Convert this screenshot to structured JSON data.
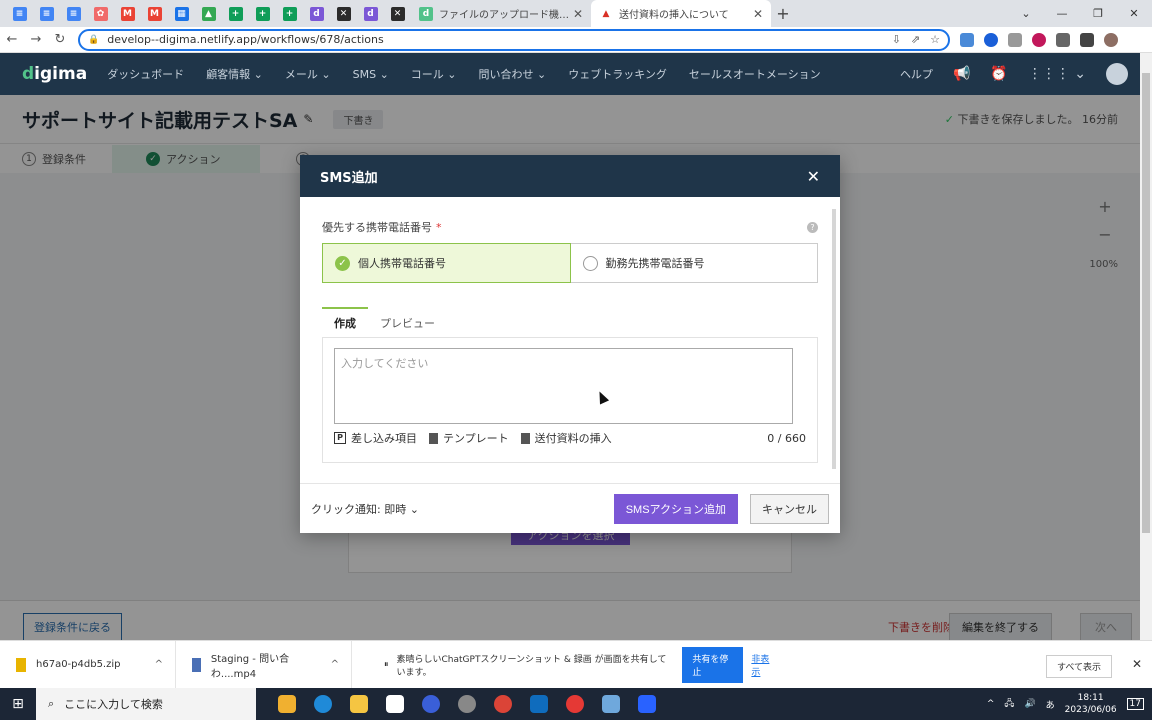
{
  "browser": {
    "pinned_tabs": [
      {
        "icon": "docs-icon",
        "color": "#4285f4",
        "glyph": "≡"
      },
      {
        "icon": "docs-icon",
        "color": "#4285f4",
        "glyph": "≡"
      },
      {
        "icon": "docs-icon",
        "color": "#4285f4",
        "glyph": "≡"
      },
      {
        "icon": "asana-icon",
        "color": "#f06a6a",
        "glyph": "✿"
      },
      {
        "icon": "gmail-icon",
        "color": "#ea4335",
        "glyph": "M"
      },
      {
        "icon": "gmail-icon",
        "color": "#ea4335",
        "glyph": "M"
      },
      {
        "icon": "calendar-icon",
        "color": "#1a73e8",
        "glyph": "▦"
      },
      {
        "icon": "drive-icon",
        "color": "#34a853",
        "glyph": "▲"
      },
      {
        "icon": "sheets-icon",
        "color": "#0f9d58",
        "glyph": "+"
      },
      {
        "icon": "sheets-icon",
        "color": "#0f9d58",
        "glyph": "+"
      },
      {
        "icon": "sheets-icon",
        "color": "#0f9d58",
        "glyph": "+"
      },
      {
        "icon": "digima-icon",
        "color": "#7b57d6",
        "glyph": "d"
      },
      {
        "icon": "app-icon",
        "color": "#2b2b2b",
        "glyph": "✕"
      },
      {
        "icon": "digima-icon",
        "color": "#7b57d6",
        "glyph": "d"
      },
      {
        "icon": "app-icon",
        "color": "#2b2b2b",
        "glyph": "✕"
      }
    ],
    "tabs": [
      {
        "title": "ファイルのアップロード機能について - ",
        "favicon_color": "#52c28a",
        "glyph": "d"
      },
      {
        "title": "送付資料の挿入について",
        "favicon_color": "#d93025",
        "glyph": "▲"
      }
    ],
    "new_tab": "+",
    "window_controls": [
      "⌄",
      "—",
      "❐",
      "✕"
    ],
    "url": "develop--digima.netlify.app/workflows/678/actions"
  },
  "appnav": {
    "logo_prefix": "d",
    "logo_rest": "igima",
    "items": [
      "ダッシュボード",
      "顧客情報 ⌄",
      "メール ⌄",
      "SMS ⌄",
      "コール ⌄",
      "問い合わせ ⌄",
      "ウェブトラッキング",
      "セールスオートメーション"
    ],
    "help": "ヘルプ"
  },
  "page": {
    "title": "サポートサイト記載用テストSA",
    "status": "下書き",
    "saved_check": "✓ ",
    "saved_text": "下書きを保存しました。",
    "saved_time": "16分前",
    "steps": [
      {
        "num": "1",
        "label": "登録条件"
      },
      {
        "num": "✓",
        "label": "アクション"
      },
      {
        "num": "3",
        "label": ""
      }
    ],
    "zoom_plus": "+",
    "zoom_minus": "−",
    "zoom_level": "100%",
    "back_button": "登録条件に戻る",
    "delete_draft": "下書きを削除",
    "finish_edit": "編集を終了する",
    "next": "次へ",
    "behind_button": "アクションを選択"
  },
  "modal": {
    "title": "SMS追加",
    "close": "✕",
    "field_label": "優先する携帯電話番号",
    "required_mark": "*",
    "help": "?",
    "options": [
      "個人携帯電話番号",
      "勤務先携帯電話番号"
    ],
    "selected_option_index": 0,
    "tabs": [
      "作成",
      "プレビュー"
    ],
    "active_tab": "作成",
    "textarea_placeholder": "入力してください",
    "tools": [
      "差し込み項目",
      "テンプレート",
      "送付資料の挿入"
    ],
    "char_count": "0 / 660",
    "click_notice": "クリック通知: 即時 ⌄",
    "primary_button": "SMSアクション追加",
    "cancel_button": "キャンセル"
  },
  "downloads": {
    "items": [
      {
        "name": "h67a0-p4db5.zip"
      },
      {
        "name": "Staging - 問い合わ....mp4"
      }
    ],
    "share_text": "素晴らしいChatGPTスクリーンショット & 録画 が画面を共有しています。",
    "stop_share": "共有を停止",
    "hide": "非表示",
    "show_all": "すべて表示"
  },
  "taskbar": {
    "search_placeholder": "ここに入力して検索",
    "time": "18:11",
    "date": "2023/06/06",
    "ime": "あ",
    "notifications": "17"
  },
  "colors": {
    "nav_bg": "#1f3549",
    "accent_green": "#8cc34a",
    "primary_purple": "#7b57d6",
    "chrome_blue": "#1a73e8"
  }
}
